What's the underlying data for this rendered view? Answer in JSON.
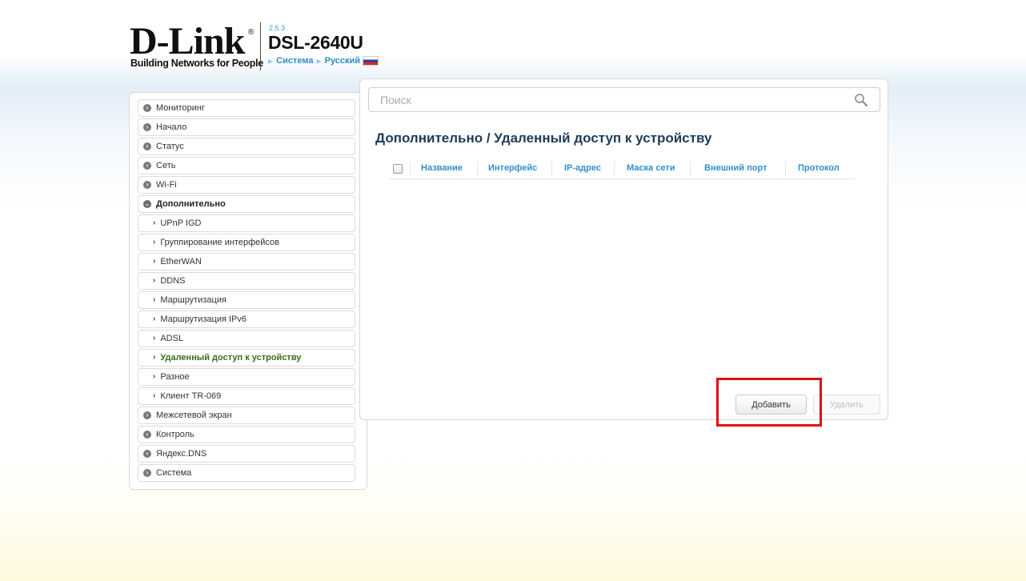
{
  "header": {
    "brand": "D-Link",
    "brand_registered": "®",
    "tagline": "Building Networks for People",
    "firmware_version": "2.5.3",
    "model": "DSL-2640U",
    "nav": [
      "Система",
      "Русский"
    ],
    "flag_colors": [
      "#ffffff",
      "#1e3fb0",
      "#d52b1e"
    ]
  },
  "search": {
    "placeholder": "Поиск",
    "value": ""
  },
  "sidebar": {
    "items": [
      {
        "label": "Мониторинг",
        "level": 0
      },
      {
        "label": "Начало",
        "level": 0
      },
      {
        "label": "Статус",
        "level": 0
      },
      {
        "label": "Сеть",
        "level": 0
      },
      {
        "label": "Wi-Fi",
        "level": 0
      },
      {
        "label": "Дополнительно",
        "level": 0,
        "expanded": true
      },
      {
        "label": "UPnP IGD",
        "level": 1
      },
      {
        "label": "Группирование интерфейсов",
        "level": 1
      },
      {
        "label": "EtherWAN",
        "level": 1
      },
      {
        "label": "DDNS",
        "level": 1
      },
      {
        "label": "Маршрутизация",
        "level": 1
      },
      {
        "label": "Маршрутизация IPv6",
        "level": 1
      },
      {
        "label": "ADSL",
        "level": 1
      },
      {
        "label": "Удаленный доступ к устройству",
        "level": 1,
        "active": true
      },
      {
        "label": "Разное",
        "level": 1
      },
      {
        "label": "Клиент TR-069",
        "level": 1
      },
      {
        "label": "Межсетевой экран",
        "level": 0
      },
      {
        "label": "Контроль",
        "level": 0
      },
      {
        "label": "Яндекс.DNS",
        "level": 0
      },
      {
        "label": "Система",
        "level": 0
      }
    ]
  },
  "main": {
    "title": "Дополнительно /  Удаленный доступ к устройству",
    "table": {
      "columns": [
        "Название",
        "Интерфейс",
        "IP-адрес",
        "Маска сети",
        "Внешний порт",
        "Протокол"
      ],
      "rows": []
    },
    "buttons": {
      "add": "Добавить",
      "delete": "Удалить"
    }
  },
  "colors": {
    "accent": "#2f8fcf",
    "title": "#1c3b57",
    "active_item": "#3a6e1a",
    "highlight": "#e01010"
  }
}
